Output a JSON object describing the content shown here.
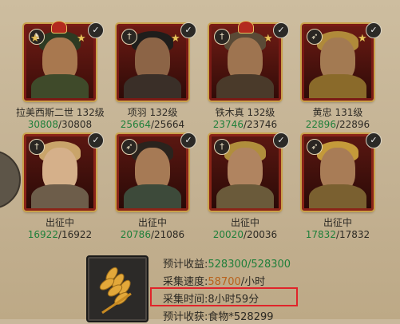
{
  "heroes": [
    {
      "name": "拉美西斯二世",
      "level": "132级",
      "troops_current": "30808",
      "troops_max": "30808",
      "type_icon": "cavalry-icon",
      "checked": true
    },
    {
      "name": "项羽",
      "level": "132级",
      "troops_current": "25664",
      "troops_max": "25664",
      "type_icon": "sword-icon",
      "checked": true
    },
    {
      "name": "铁木真",
      "level": "132级",
      "troops_current": "23746",
      "troops_max": "23746",
      "type_icon": "sword-icon",
      "checked": true
    },
    {
      "name": "黄忠",
      "level": "131级",
      "troops_current": "22896",
      "troops_max": "22896",
      "type_icon": "bow-icon",
      "checked": true
    },
    {
      "status": "出征中",
      "troops_current": "16922",
      "troops_max": "16922",
      "type_icon": "sword-icon",
      "checked": true
    },
    {
      "status": "出征中",
      "troops_current": "20786",
      "troops_max": "21086",
      "type_icon": "bow-icon",
      "checked": true
    },
    {
      "status": "出征中",
      "troops_current": "20020",
      "troops_max": "20036",
      "type_icon": "sword-icon",
      "checked": true
    },
    {
      "status": "出征中",
      "troops_current": "17832",
      "troops_max": "17832",
      "type_icon": "bow-icon",
      "checked": true
    }
  ],
  "gathering": {
    "resource_icon": "wheat-icon",
    "expected_yield_label": "预计收益:",
    "expected_yield_value": "528300/528300",
    "speed_label": "采集速度:",
    "speed_value": "58700",
    "speed_unit": "/小时",
    "time_label": "采集时间:",
    "time_value": "8小时59分",
    "expected_gain_label": "预计收获:",
    "expected_gain_value": "食物*528299"
  },
  "colors": {
    "troops_green": "#1f7f3a",
    "speed_orange": "#b8621c",
    "highlight_red": "#e0242a"
  }
}
